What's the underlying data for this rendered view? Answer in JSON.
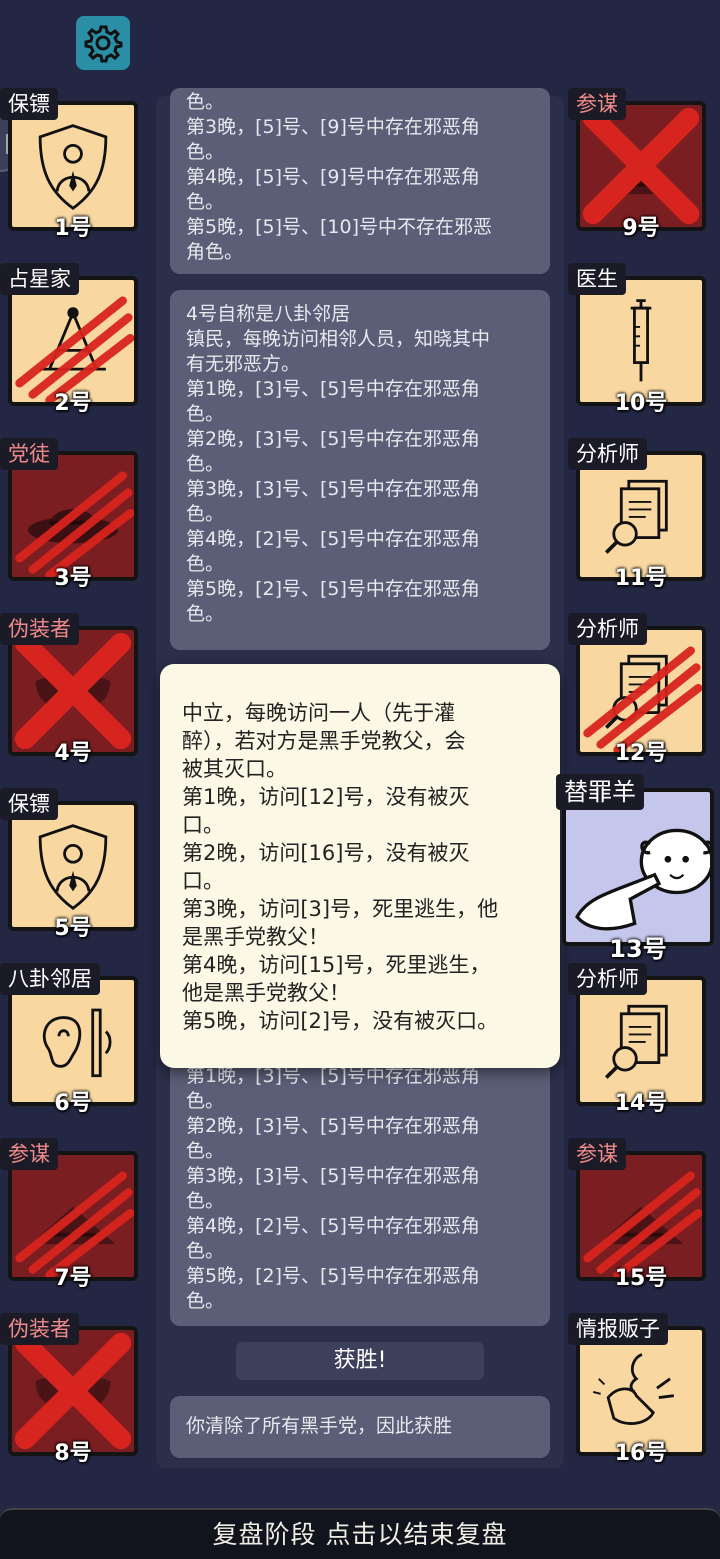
{
  "log_cards": [
    {
      "name": "log-card-top",
      "lines": [
        "色。",
        "第3晚，[5]号、[9]号中存在邪恶角",
        "色。",
        "第4晚，[5]号、[9]号中存在邪恶角",
        "色。",
        "第5晚，[5]号、[10]号中不存在邪恶",
        "角色。"
      ]
    },
    {
      "name": "log-card-player-4",
      "lines": [
        "4号自称是八卦邻居",
        "镇民，每晚访问相邻人员，知晓其中",
        "有无邪恶方。",
        "第1晚，[3]号、[5]号中存在邪恶角",
        "色。",
        "第2晚，[3]号、[5]号中存在邪恶角",
        "色。",
        "第3晚，[3]号、[5]号中存在邪恶角",
        "色。",
        "第4晚，[2]号、[5]号中存在邪恶角",
        "色。",
        "第5晚，[2]号、[5]号中存在邪恶角",
        "色。"
      ]
    },
    {
      "name": "log-card-lower",
      "lines": [
        "第1晚，[3]号、[5]号中存在邪恶角",
        "色。",
        "第2晚，[3]号、[5]号中存在邪恶角",
        "色。",
        "第3晚，[3]号、[5]号中存在邪恶角",
        "色。",
        "第4晚，[2]号、[5]号中存在邪恶角",
        "色。",
        "第5晚，[2]号、[5]号中存在邪恶角",
        "色。"
      ]
    },
    {
      "name": "victory-message",
      "lines": [
        "你清除了所有黑手党，因此获胜"
      ]
    }
  ],
  "popup": {
    "lines": [
      "中立，每晚访问一人（先于灌",
      "醉），若对方是黑手党教父，会",
      "被其灭口。",
      "第1晚，访问[12]号，没有被灭",
      "口。",
      "第2晚，访问[16]号，没有被灭",
      "口。",
      "第3晚，访问[3]号，死里逃生，他",
      "是黑手党教父！",
      "第4晚，访问[15]号，死里逃生，",
      "他是黑手党教父！",
      "第5晚，访问[2]号，没有被灭口。"
    ]
  },
  "win_label": "获胜!",
  "bottom_bar": "复盘阶段 点击以结束复盘",
  "players": [
    {
      "num": "1号",
      "role": "保镖",
      "evil": false,
      "state": "alive",
      "mark": "none",
      "icon": "bodyguard-shield-icon"
    },
    {
      "num": "2号",
      "role": "占星家",
      "evil": false,
      "state": "alive",
      "mark": "claw",
      "icon": "sextant-icon"
    },
    {
      "num": "3号",
      "role": "党徒",
      "evil": true,
      "state": "dead",
      "mark": "claw",
      "icon": "mafia-hat-icon"
    },
    {
      "num": "4号",
      "role": "伪装者",
      "evil": true,
      "state": "dead",
      "mark": "x",
      "icon": "mask-icon"
    },
    {
      "num": "5号",
      "role": "保镖",
      "evil": false,
      "state": "alive",
      "mark": "none",
      "icon": "bodyguard-shield-icon"
    },
    {
      "num": "6号",
      "role": "八卦邻居",
      "evil": false,
      "state": "alive",
      "mark": "none",
      "icon": "ear-wall-icon"
    },
    {
      "num": "7号",
      "role": "参谋",
      "evil": true,
      "state": "dead",
      "mark": "claw",
      "icon": "plan-icon"
    },
    {
      "num": "8号",
      "role": "伪装者",
      "evil": true,
      "state": "dead",
      "mark": "x",
      "icon": "mask-icon"
    },
    {
      "num": "9号",
      "role": "参谋",
      "evil": true,
      "state": "dead",
      "mark": "x",
      "icon": "plan-icon"
    },
    {
      "num": "10号",
      "role": "医生",
      "evil": false,
      "state": "alive",
      "mark": "none",
      "icon": "syringe-icon"
    },
    {
      "num": "11号",
      "role": "分析师",
      "evil": false,
      "state": "alive",
      "mark": "none",
      "icon": "analyst-docs-icon"
    },
    {
      "num": "12号",
      "role": "分析师",
      "evil": false,
      "state": "alive",
      "mark": "claw",
      "icon": "analyst-docs-icon"
    },
    {
      "num": "13号",
      "role": "替罪羊",
      "evil": false,
      "state": "scape",
      "mark": "none",
      "icon": "sheep-point-icon"
    },
    {
      "num": "14号",
      "role": "分析师",
      "evil": false,
      "state": "alive",
      "mark": "none",
      "icon": "analyst-docs-icon"
    },
    {
      "num": "15号",
      "role": "参谋",
      "evil": true,
      "state": "dead",
      "mark": "claw",
      "icon": "plan-icon"
    },
    {
      "num": "16号",
      "role": "情报贩子",
      "evil": false,
      "state": "alive",
      "mark": "none",
      "icon": "whisper-icon"
    }
  ],
  "colors": {
    "background": "#232743",
    "card_alive": "#f8d7a1",
    "card_dead": "#7a1e22",
    "evil_role_text": "#f08a8a",
    "claw_mark": "#d8241e",
    "popup_bg": "#fbf8e6"
  }
}
